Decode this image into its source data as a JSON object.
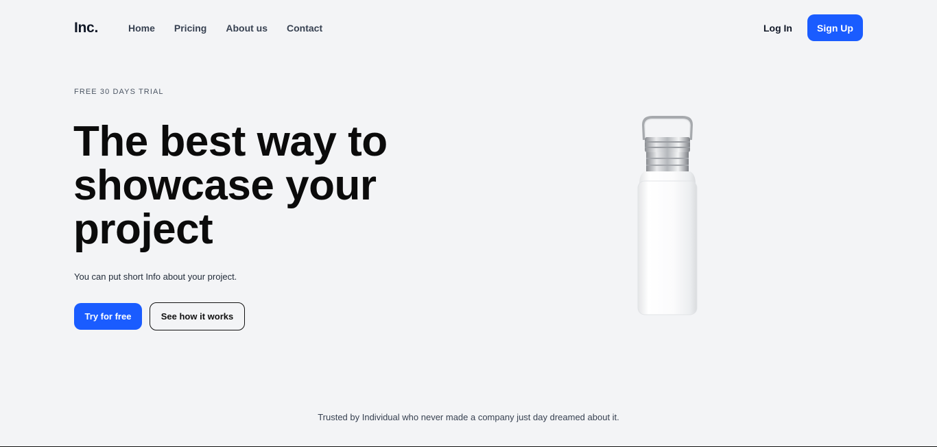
{
  "brand": {
    "logo": "Inc."
  },
  "nav": {
    "links": [
      "Home",
      "Pricing",
      "About us",
      "Contact"
    ],
    "login_label": "Log In",
    "signup_label": "Sign Up"
  },
  "hero": {
    "eyebrow": "FREE 30 DAYS TRIAL",
    "headline": "The best way to showcase your project",
    "subtext": "You can put short Info about your project.",
    "primary_cta": "Try for free",
    "secondary_cta": "See how it works"
  },
  "footer": {
    "trusted_text": "Trusted by Individual who never made a company just day dreamed about it."
  },
  "colors": {
    "accent": "#1a5cff",
    "background": "#f3f4f6"
  }
}
